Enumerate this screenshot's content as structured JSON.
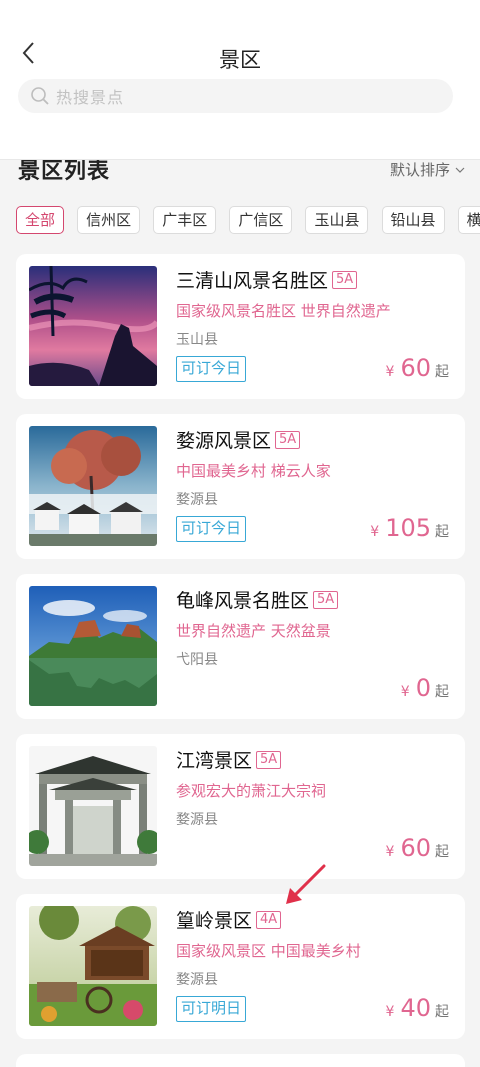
{
  "header": {
    "title": "景区",
    "search_placeholder": "热搜景点"
  },
  "list": {
    "title": "景区列表",
    "sort_label": "默认排序"
  },
  "filters": [
    "全部",
    "信州区",
    "广丰区",
    "广信区",
    "玉山县",
    "铅山县",
    "横峰县"
  ],
  "cards": [
    {
      "name": "三清山风景名胜区",
      "level": "5A",
      "tags": "国家级风景名胜区 世界自然遗产",
      "area": "玉山县",
      "booking": "可订今日",
      "currency": "¥",
      "price": "60",
      "suffix": "起"
    },
    {
      "name": "婺源风景区",
      "level": "5A",
      "tags": "中国最美乡村 梯云人家",
      "area": "婺源县",
      "booking": "可订今日",
      "currency": "¥",
      "price": "105",
      "suffix": "起"
    },
    {
      "name": "龟峰风景名胜区",
      "level": "5A",
      "tags": "世界自然遗产 天然盆景",
      "area": "弋阳县",
      "booking": "",
      "currency": "¥",
      "price": "0",
      "suffix": "起"
    },
    {
      "name": "江湾景区",
      "level": "5A",
      "tags": "参观宏大的萧江大宗祠",
      "area": "婺源县",
      "booking": "",
      "currency": "¥",
      "price": "60",
      "suffix": "起"
    },
    {
      "name": "篁岭景区",
      "level": "4A",
      "tags": "国家级风景区 中国最美乡村",
      "area": "婺源县",
      "booking": "可订明日",
      "currency": "¥",
      "price": "40",
      "suffix": "起"
    }
  ],
  "colors": {
    "accent_pink": "#e06690",
    "booking_blue": "#38a8d6",
    "annotation_red": "#e0304a"
  }
}
